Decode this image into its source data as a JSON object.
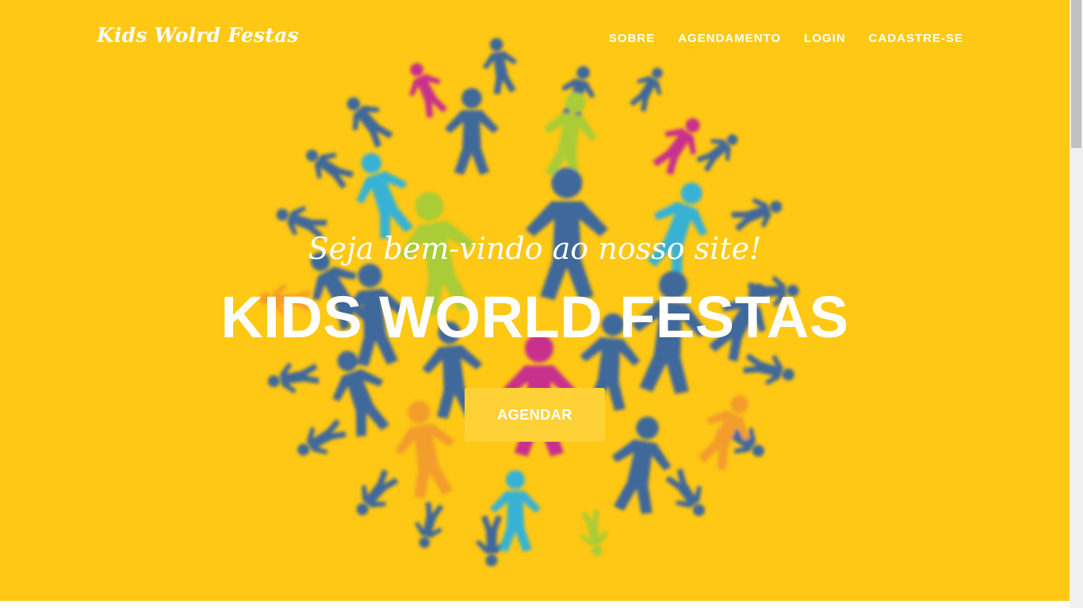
{
  "navbar": {
    "brand": "Kids Wolrd Festas",
    "links": [
      "SOBRE",
      "AGENDAMENTO",
      "LOGIN",
      "CADASTRE-SE"
    ]
  },
  "hero": {
    "subheading": "Seja bem-vindo ao nosso site!",
    "heading": "KIDS WORLD FESTAS",
    "cta_label": "AGENDAR",
    "background_color": "#fec815",
    "button_color": "#fed136",
    "image": "children-globe-illustration"
  },
  "colors": {
    "blue": "#2e5ea8",
    "light_blue": "#25b0e6",
    "green": "#a2cc3a",
    "magenta": "#c4219a",
    "orange": "#f29a2e"
  }
}
